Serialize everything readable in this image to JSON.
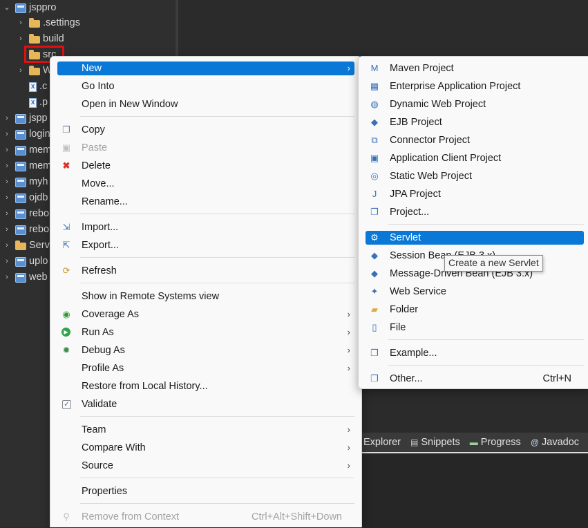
{
  "explorer": {
    "items": [
      {
        "label": "jsppro",
        "chevron": "⌄",
        "icon": "project"
      },
      {
        "label": ".settings",
        "chevron": "›",
        "icon": "folder"
      },
      {
        "label": "build",
        "chevron": "›",
        "icon": "folder"
      },
      {
        "label": "src",
        "chevron": "",
        "icon": "folder"
      },
      {
        "label": "W",
        "chevron": "›",
        "icon": "folder"
      },
      {
        "label": ".c",
        "chevron": "",
        "icon": "file"
      },
      {
        "label": ".p",
        "chevron": "",
        "icon": "file"
      },
      {
        "label": "jspp",
        "chevron": "›",
        "icon": "project"
      },
      {
        "label": "login",
        "chevron": "›",
        "icon": "project"
      },
      {
        "label": "mem",
        "chevron": "›",
        "icon": "project"
      },
      {
        "label": "mem",
        "chevron": "›",
        "icon": "project"
      },
      {
        "label": "myh",
        "chevron": "›",
        "icon": "project"
      },
      {
        "label": "ojdb",
        "chevron": "›",
        "icon": "project"
      },
      {
        "label": "rebo",
        "chevron": "›",
        "icon": "project"
      },
      {
        "label": "rebo",
        "chevron": "›",
        "icon": "project"
      },
      {
        "label": "Serv",
        "chevron": "›",
        "icon": "folder"
      },
      {
        "label": "uplo",
        "chevron": "›",
        "icon": "project"
      },
      {
        "label": "web",
        "chevron": "›",
        "icon": "project"
      }
    ]
  },
  "context_menu": {
    "new": "New",
    "go_into": "Go Into",
    "open_new_window": "Open in New Window",
    "copy": "Copy",
    "paste": "Paste",
    "delete": "Delete",
    "move": "Move...",
    "rename": "Rename...",
    "import": "Import...",
    "export": "Export...",
    "refresh": "Refresh",
    "show_remote": "Show in Remote Systems view",
    "coverage_as": "Coverage As",
    "run_as": "Run As",
    "debug_as": "Debug As",
    "profile_as": "Profile As",
    "restore_history": "Restore from Local History...",
    "validate": "Validate",
    "team": "Team",
    "compare_with": "Compare With",
    "source": "Source",
    "properties": "Properties",
    "remove_context": "Remove from Context",
    "remove_context_shortcut": "Ctrl+Alt+Shift+Down",
    "arrow": "›"
  },
  "new_submenu": {
    "maven_project": "Maven Project",
    "enterprise_app": "Enterprise Application Project",
    "dynamic_web": "Dynamic Web Project",
    "ejb_project": "EJB Project",
    "connector_project": "Connector Project",
    "app_client": "Application Client Project",
    "static_web": "Static Web Project",
    "jpa_project": "JPA Project",
    "project": "Project...",
    "servlet": "Servlet",
    "session_bean": "Session Bean (EJB 3.x)",
    "mdb": "Message-Driven Bean (EJB 3.x)",
    "web_service": "Web Service",
    "folder": "Folder",
    "file": "File",
    "example": "Example...",
    "other": "Other...",
    "other_shortcut": "Ctrl+N"
  },
  "tooltip": {
    "text": "Create a new Servlet"
  },
  "bottom_tabs": {
    "explorer": "Explorer",
    "snippets": "Snippets",
    "progress": "Progress",
    "javadoc": "Javadoc"
  },
  "colors": {
    "selection": "#0a78d7",
    "highlight_box": "#e01010"
  }
}
